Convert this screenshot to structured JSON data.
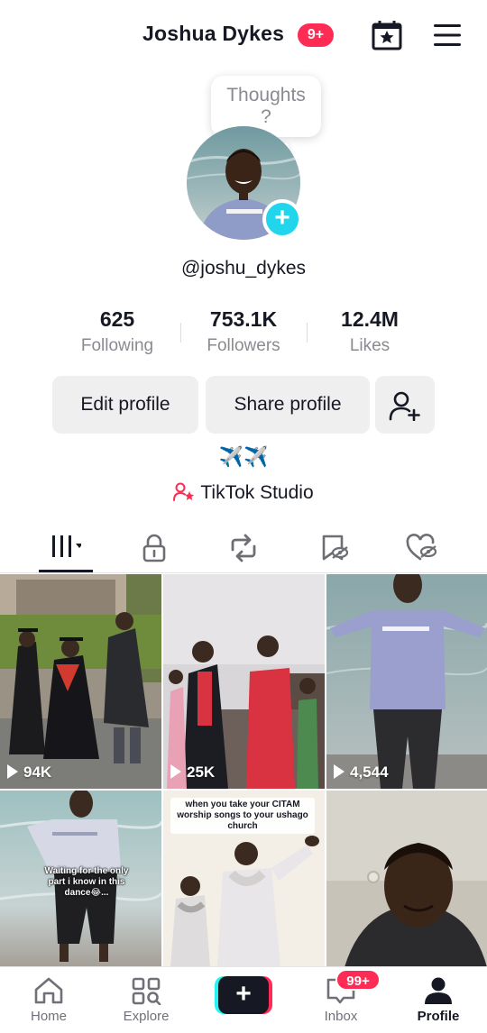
{
  "header": {
    "display_name": "Joshua Dykes",
    "notification_badge": "9+",
    "calendar_icon": "calendar-star-icon",
    "menu_icon": "hamburger-menu-icon"
  },
  "profile": {
    "thought_bubble": "Thoughts ?",
    "handle": "@joshu_dykes",
    "bio": "✈️✈️",
    "studio_link": "TikTok Studio"
  },
  "stats": [
    {
      "value": "625",
      "label": "Following"
    },
    {
      "value": "753.1K",
      "label": "Followers"
    },
    {
      "value": "12.4M",
      "label": "Likes"
    }
  ],
  "buttons": {
    "edit": "Edit profile",
    "share": "Share profile",
    "add_friend_icon": "add-friend-icon"
  },
  "tabs": [
    {
      "icon": "videos-grid-icon",
      "active": true
    },
    {
      "icon": "lock-icon",
      "active": false
    },
    {
      "icon": "repost-icon",
      "active": false
    },
    {
      "icon": "favorites-icon",
      "active": false
    },
    {
      "icon": "liked-icon",
      "active": false
    }
  ],
  "videos": [
    {
      "views": "94K",
      "caption": ""
    },
    {
      "views": "25K",
      "caption": ""
    },
    {
      "views": "4,544",
      "caption": ""
    },
    {
      "views": "",
      "caption": "Waiting for the only part i know in this dance😂..."
    },
    {
      "views": "",
      "caption": "when you take your CITAM worship songs to your ushago church"
    },
    {
      "views": "",
      "caption": ""
    }
  ],
  "bottom_nav": {
    "home": "Home",
    "explore": "Explore",
    "inbox": "Inbox",
    "inbox_badge": "99+",
    "profile": "Profile"
  },
  "colors": {
    "accent_red": "#fe2c55",
    "accent_cyan": "#25f4ee",
    "avatar_plus": "#20d5ec"
  }
}
